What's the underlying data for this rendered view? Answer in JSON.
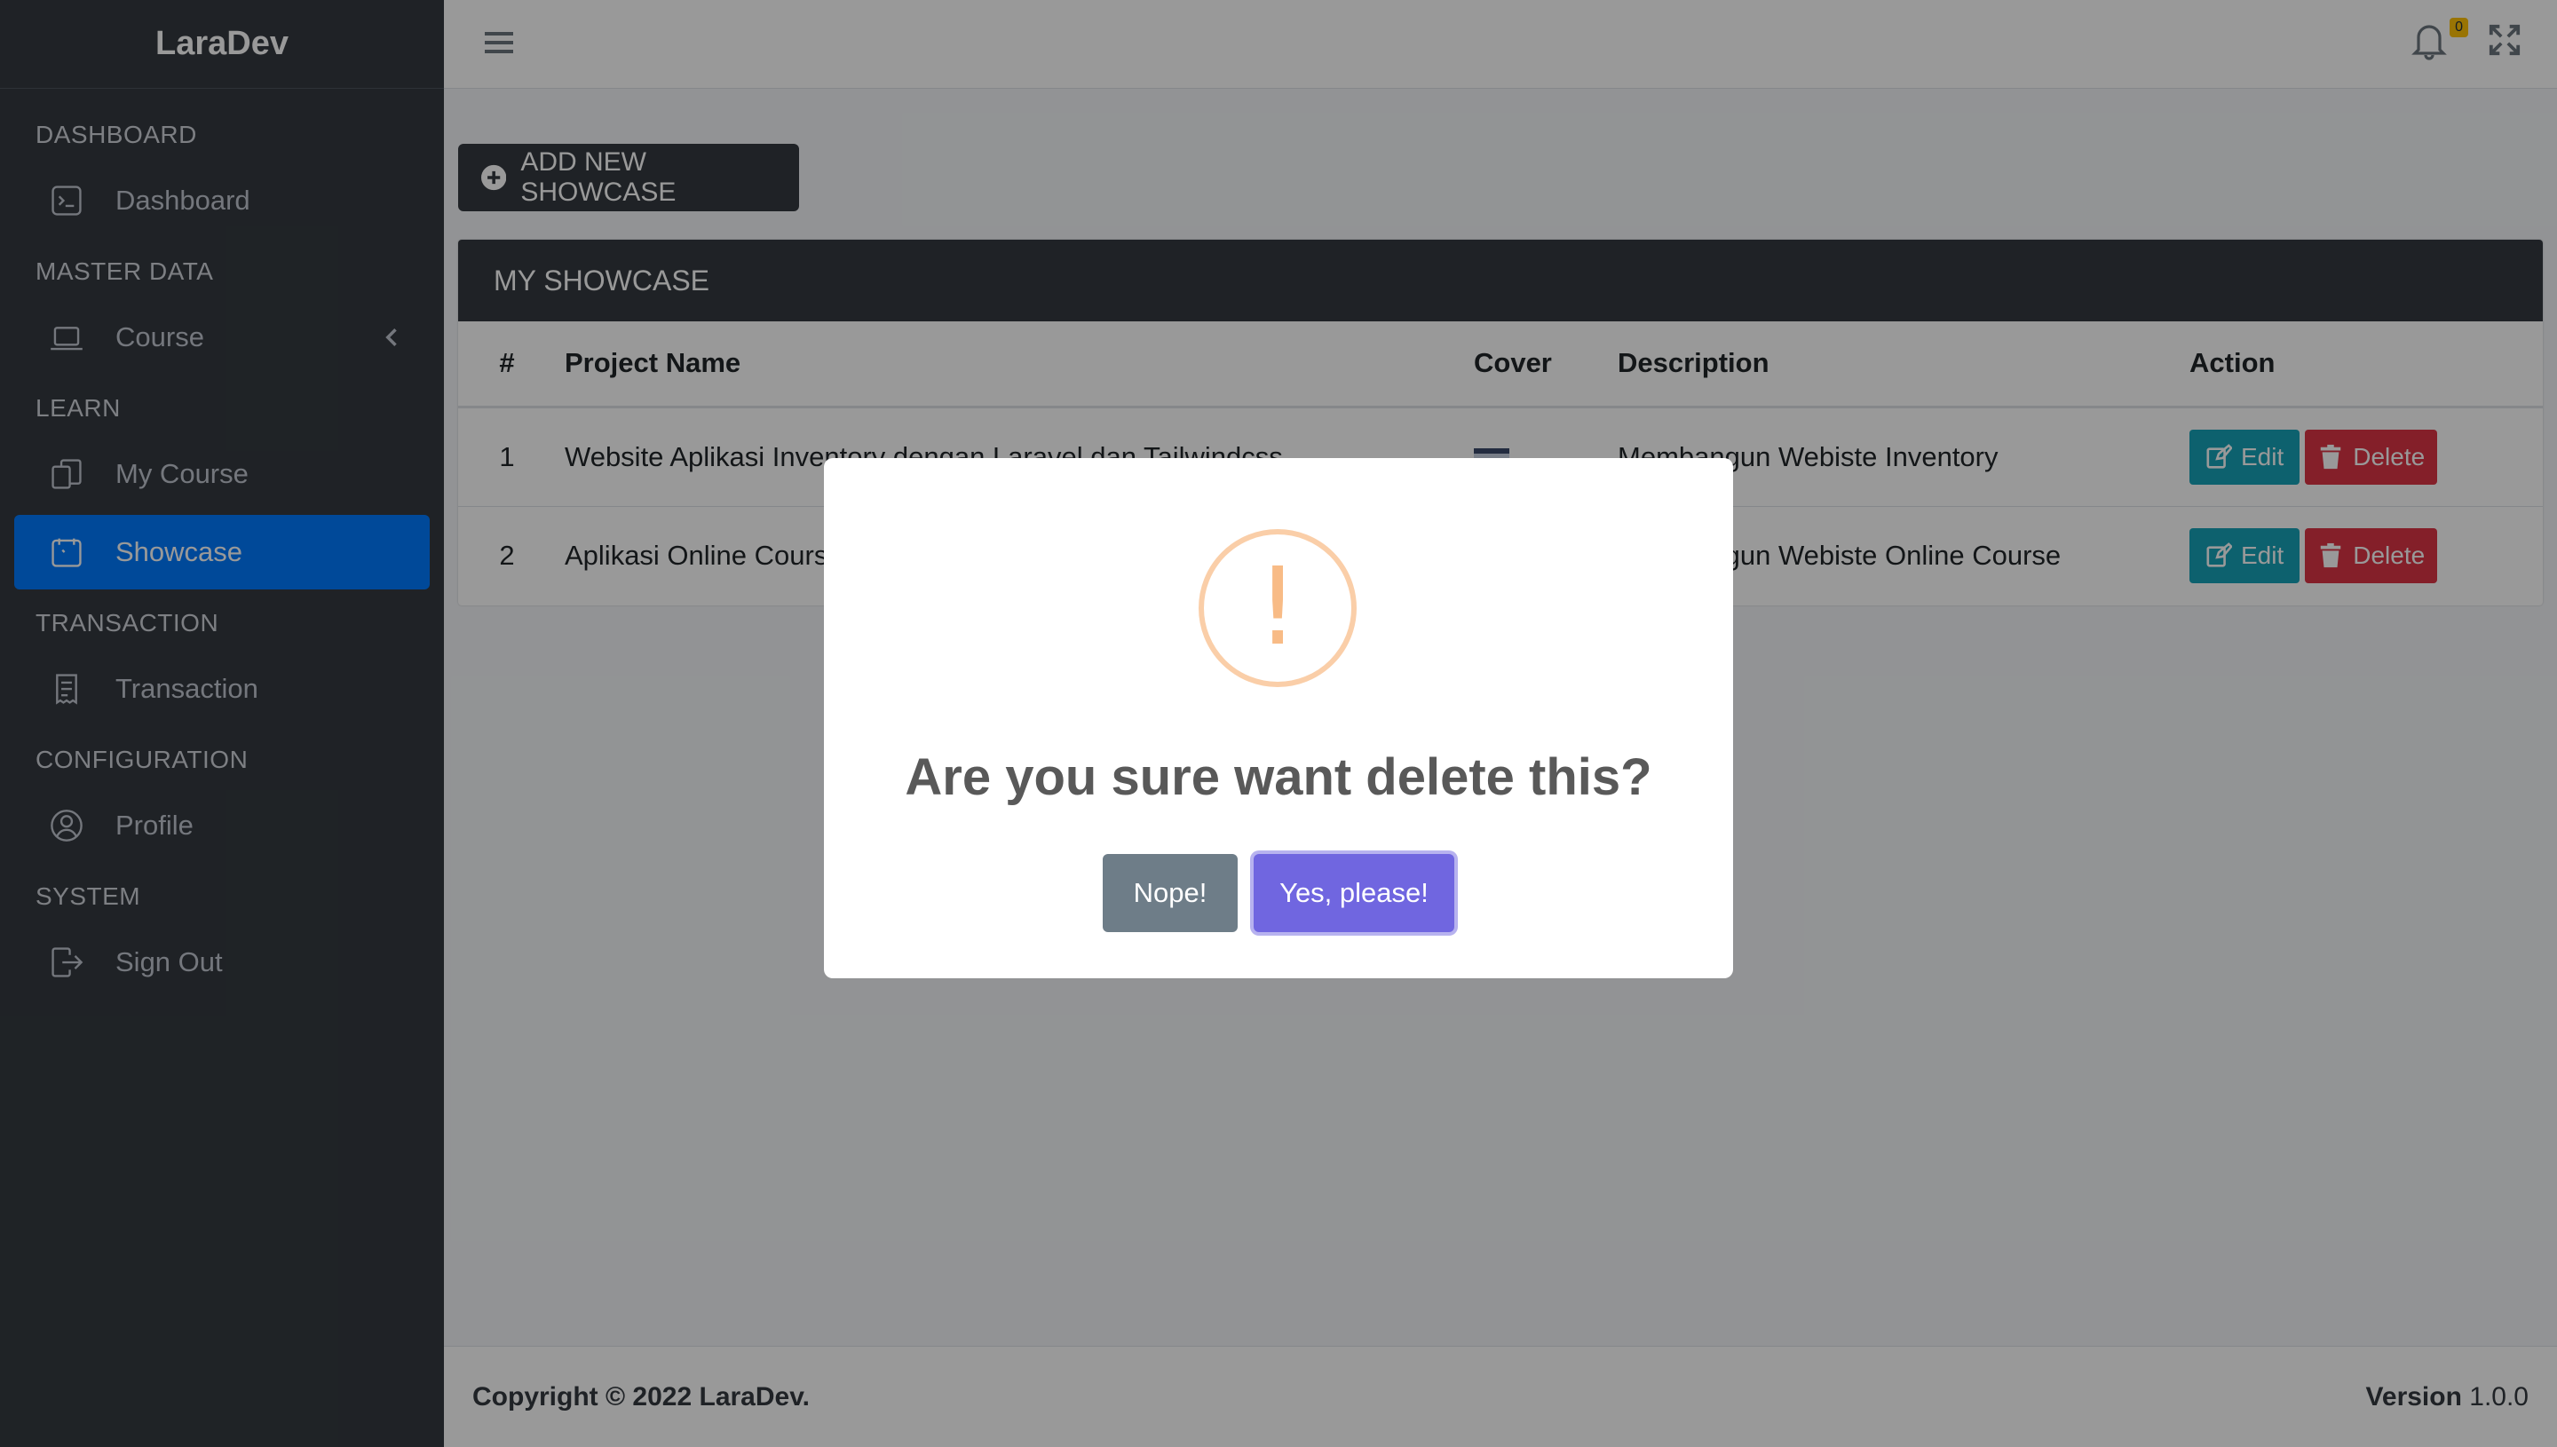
{
  "brand": "LaraDev",
  "sidebar": {
    "sections": [
      {
        "header": "DASHBOARD",
        "items": [
          {
            "label": "Dashboard",
            "icon": "terminal-icon"
          }
        ]
      },
      {
        "header": "MASTER DATA",
        "items": [
          {
            "label": "Course",
            "icon": "laptop-icon"
          }
        ]
      },
      {
        "header": "LEARN",
        "items": [
          {
            "label": "My Course",
            "icon": "copy-icon"
          },
          {
            "label": "Showcase",
            "icon": "bounding-box-icon",
            "active": true
          }
        ]
      },
      {
        "header": "TRANSACTION",
        "items": [
          {
            "label": "Transaction",
            "icon": "receipt-icon"
          }
        ]
      },
      {
        "header": "CONFIGURATION",
        "items": [
          {
            "label": "Profile",
            "icon": "person-circle-icon"
          }
        ]
      },
      {
        "header": "SYSTEM",
        "items": [
          {
            "label": "Sign Out",
            "icon": "sign-out-icon"
          }
        ]
      }
    ]
  },
  "topbar": {
    "notification_count": "0"
  },
  "main": {
    "add_button": "ADD NEW SHOWCASE",
    "card_title": "MY SHOWCASE",
    "table": {
      "headers": [
        "#",
        "Project Name",
        "Cover",
        "Description",
        "Action"
      ],
      "rows": [
        {
          "num": "1",
          "name": "Website Aplikasi Inventory dengan Laravel dan Tailwindcss",
          "description": "Membangun Webiste Inventory"
        },
        {
          "num": "2",
          "name": "Aplikasi Online Course",
          "description": "Membangun Webiste Online Course"
        }
      ],
      "edit_label": "Edit",
      "delete_label": "Delete"
    }
  },
  "footer": {
    "copyright": "Copyright © 2022 LaraDev.",
    "version_label": "Version",
    "version": "1.0.0"
  },
  "modal": {
    "icon": "!",
    "title": "Are you sure want delete this?",
    "cancel": "Nope!",
    "confirm": "Yes, please!"
  },
  "colors": {
    "sidebar_bg": "#343a40",
    "active": "#007bff",
    "edit": "#17a2b8",
    "delete": "#dc3545",
    "confirm": "#7066e0",
    "cancel": "#6e7d88",
    "warning": "#f8bb86"
  }
}
